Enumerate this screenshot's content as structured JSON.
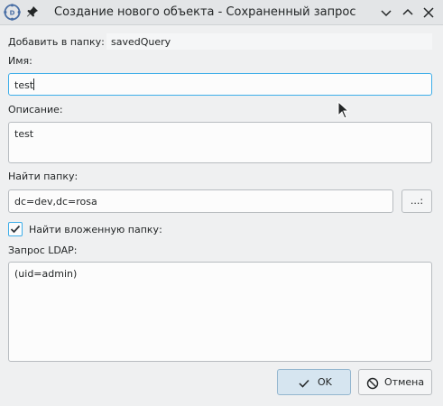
{
  "window": {
    "title": "Создание нового объекта - Сохраненный запрос",
    "accent_color": "#3daee9"
  },
  "icons": {
    "app": "ad-manager-app-icon",
    "pin": "pin-icon",
    "minimize": "chevron-down-icon",
    "maximize": "chevron-up-icon",
    "close": "close-icon",
    "checkbox": "checkmark-icon",
    "ok": "checkmark-icon",
    "cancel": "cancel-icon",
    "cursor": "mouse-pointer-icon"
  },
  "form": {
    "add_to_folder_label": "Добавить в папку:",
    "add_to_folder_value": "savedQuery",
    "name_label": "Имя:",
    "name_value": "test",
    "description_label": "Описание:",
    "description_value": "test",
    "search_folder_label": "Найти папку:",
    "search_folder_value": "dc=dev,dc=rosa",
    "browse_button_label": "...:",
    "search_nested_label": "Найти вложенную папку:",
    "search_nested_checked": true,
    "ldap_query_label": "Запрос LDAP:",
    "ldap_query_value": "(uid=admin)"
  },
  "buttons": {
    "ok_label": "OK",
    "cancel_label": "Отмена"
  }
}
